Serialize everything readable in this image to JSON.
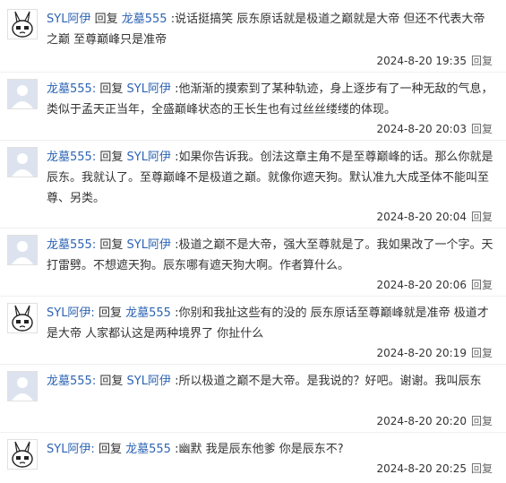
{
  "reply_word": "回复",
  "comments": [
    {
      "avatar": "cartoon-rabbit",
      "author": "SYL阿伊",
      "target": "龙墓555",
      "text": ":说话挺搞笑 辰东原话就是极道之巅就是大帝 但还不代表大帝之巅 至尊巅峰只是准帝",
      "time": "2024-8-20 19:35",
      "reply": "回复"
    },
    {
      "avatar": "default-user",
      "author": "龙墓555:",
      "target": "SYL阿伊",
      "text": ":他渐渐的摸索到了某种轨迹，身上逐步有了一种无敌的气息，类似于孟天正当年，全盛巅峰状态的王长生也有过丝丝缕缕的体现。",
      "time": "2024-8-20 20:03",
      "reply": "回复"
    },
    {
      "avatar": "default-user",
      "author": "龙墓555:",
      "target": "SYL阿伊",
      "text": ":如果你告诉我。创法这章主角不是至尊巅峰的话。那么你就是辰东。我就认了。至尊巅峰不是极道之巅。就像你遮天狗。默认准九大成圣体不能叫至尊、另类。",
      "time": "2024-8-20 20:04",
      "reply": "回复"
    },
    {
      "avatar": "default-user",
      "author": "龙墓555:",
      "target": "SYL阿伊",
      "text": ":极道之巅不是大帝，强大至尊就是了。我如果改了一个字。天打雷劈。不想遮天狗。辰东哪有遮天狗大啊。作者算什么。",
      "time": "2024-8-20 20:06",
      "reply": "回复"
    },
    {
      "avatar": "cartoon-rabbit",
      "author": "SYL阿伊:",
      "target": "龙墓555",
      "text": ":你别和我扯这些有的没的 辰东原话至尊巅峰就是准帝 极道才是大帝 人家都认这是两种境界了 你扯什么",
      "time": "2024-8-20 20:19",
      "reply": "回复"
    },
    {
      "avatar": "default-user",
      "author": "龙墓555:",
      "target": "SYL阿伊",
      "text": ":所以极道之巅不是大帝。是我说的？好吧。谢谢。我叫辰东",
      "time": "2024-8-20 20:20",
      "reply": "回复"
    },
    {
      "avatar": "cartoon-rabbit",
      "author": "SYL阿伊:",
      "target": "龙墓555",
      "text": ":幽默 我是辰东他爹 你是辰东不?",
      "time": "2024-8-20 20:25",
      "reply": "回复"
    }
  ]
}
